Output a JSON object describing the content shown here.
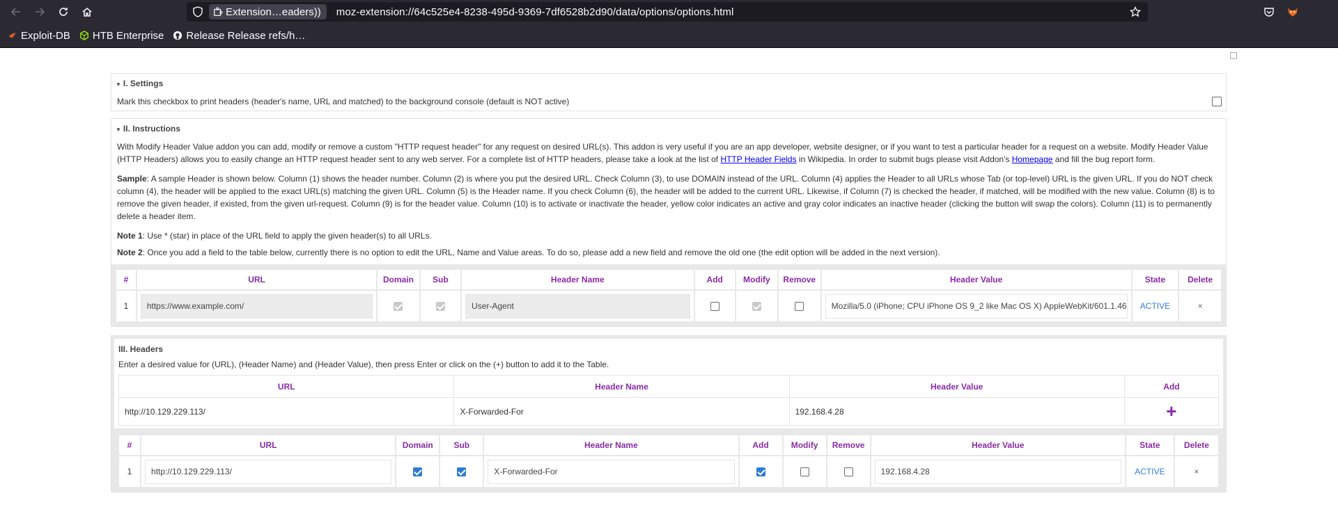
{
  "browser": {
    "extension_pill": "Extension…eaders))",
    "url": "moz-extension://64c525e4-8238-495d-9369-7df6528b2d90/data/options/options.html",
    "bookmarks": [
      {
        "label": "Exploit-DB"
      },
      {
        "label": "HTB Enterprise"
      },
      {
        "label": "Release Release refs/h…"
      }
    ]
  },
  "settings": {
    "title": "I. Settings",
    "text": "Mark this checkbox to print headers (header's name, URL and matched) to the background console (default is NOT active)",
    "checked": false
  },
  "instructions": {
    "title": "II. Instructions",
    "p1_a": "With Modify Header Value addon you can add, modify or remove a custom \"HTTP request header\" for any request on desired URL(s). This addon is very useful if you are an app developer, website designer, or if you want to test a particular header for a request on a website. Modify Header Value (HTTP Headers) allows you to easily change an HTTP request header sent to any web server. For a complete list of HTTP headers, please take a look at the list of ",
    "p1_link1": "HTTP Header Fields",
    "p1_b": " in Wikipedia. In order to submit bugs please visit Addon's ",
    "p1_link2": "Homepage",
    "p1_c": " and fill the bug report form.",
    "sample_label": "Sample",
    "sample_text": ": A sample Header is shown below. Column (1) shows the header number. Column (2) is where you put the desired URL. Check Column (3), to use DOMAIN instead of the URL. Column (4) applies the Header to all URLs whose Tab (or top-level) URL is the given URL. If you do NOT check column (4), the header will be applied to the exact URL(s) matching the given URL. Column (5) is the Header name. If you check Column (6), the header will be added to the current URL. Likewise, if Column (7) is checked the header, if matched, will be modified with the new value. Column (8) is to remove the given header, if existed, from the given url-request. Column (9) is for the header value. Column (10) is to activate or inactivate the header, yellow color indicates an active and gray color indicates an inactive header (clicking the button will swap the colors). Column (11) is to permanently delete a header item.",
    "note1_label": "Note 1",
    "note1_text": ": Use * (star) in place of the URL field to apply the given header(s) to all URLs.",
    "note2_label": "Note 2",
    "note2_text": ": Once you add a field to the table below, currently there is no option to edit the URL, Name and Value areas. To do so, please add a new field and remove the old one (the edit option will be added in the next version)."
  },
  "columns": [
    "#",
    "URL",
    "Domain",
    "Sub",
    "Header Name",
    "Add",
    "Modify",
    "Remove",
    "Header Value",
    "State",
    "Delete"
  ],
  "sample_row": {
    "num": "1",
    "url": "https://www.example.com/",
    "domain": true,
    "sub": true,
    "header_name": "User-Agent",
    "add": false,
    "modify": true,
    "remove": false,
    "header_value": "Mozilla/5.0 (iPhone; CPU iPhone OS 9_2 like Mac OS X) AppleWebKit/601.1.46",
    "state": "ACTIVE",
    "delete": "×"
  },
  "headers": {
    "title": "III. Headers",
    "description": "Enter a desired value for (URL), (Header Name) and (Header Value), then press Enter or click on the (+) button to add it to the Table.",
    "add_columns": [
      "URL",
      "Header Name",
      "Header Value",
      "Add"
    ],
    "input_url": "http://10.129.229.113/",
    "input_header_name": "X-Forwarded-For",
    "input_header_value": "192.168.4.28",
    "add_symbol": "+"
  },
  "table_row": {
    "num": "1",
    "url": "http://10.129.229.113/",
    "domain": true,
    "sub": true,
    "header_name": "X-Forwarded-For",
    "add": true,
    "modify": false,
    "remove": false,
    "header_value": "192.168.4.28",
    "state": "ACTIVE",
    "delete": "×"
  }
}
